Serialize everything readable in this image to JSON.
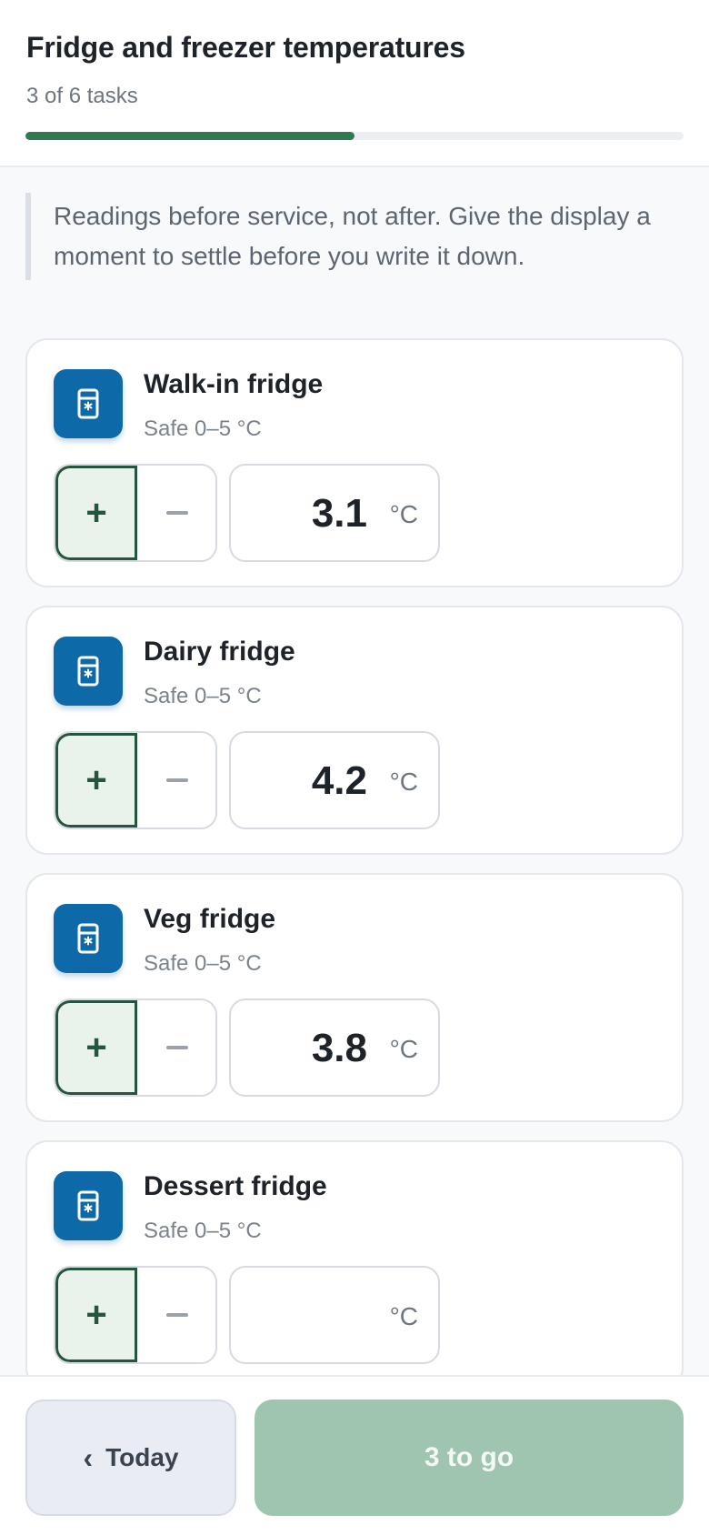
{
  "header": {
    "title": "Fridge and freezer temperatures",
    "task_status": "3 of 6 tasks",
    "progress_fraction": 0.5,
    "progress_color": "#2f7a4f"
  },
  "note": "Readings before service, not after. Give the display a moment to settle before you write it down.",
  "units": {
    "label": "°C"
  },
  "fridges": [
    {
      "name": "Walk-in fridge",
      "range": "Safe 0–5 °C",
      "reading": "3.1",
      "icon": "fridge-icon"
    },
    {
      "name": "Dairy fridge",
      "range": "Safe 0–5 °C",
      "reading": "4.2",
      "icon": "fridge-icon"
    },
    {
      "name": "Veg fridge",
      "range": "Safe 0–5 °C",
      "reading": "3.8",
      "icon": "fridge-icon"
    },
    {
      "name": "Dessert fridge",
      "range": "Safe 0–5 °C",
      "reading": "",
      "icon": "fridge-icon"
    }
  ],
  "stepper": {
    "plus": "+",
    "minus": "−"
  },
  "footer": {
    "back_label": "Today",
    "back_icon": "chevron-left-icon",
    "primary_label": "3 to go"
  },
  "colors": {
    "accent_blue": "#0e69a8",
    "accent_green": "#25553c",
    "primary_disabled": "#9fc4b0"
  }
}
